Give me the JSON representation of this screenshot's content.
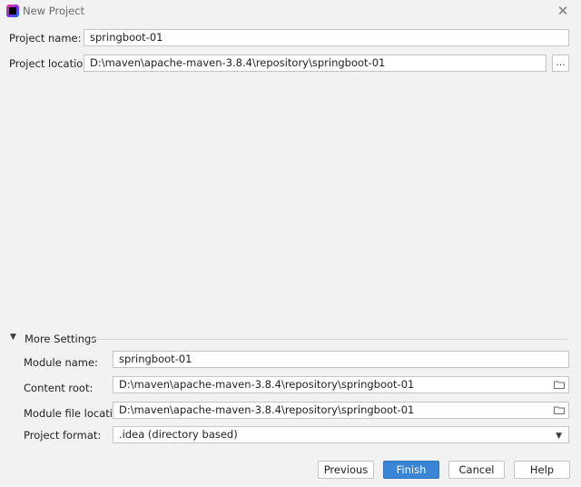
{
  "window": {
    "title": "New Project",
    "app_icon": "intellij-idea-icon",
    "close_glyph": "✕"
  },
  "project": {
    "name_label": "Project name:",
    "name_value": "springboot-01",
    "location_label": "Project location:",
    "location_value": "D:\\maven\\apache-maven-3.8.4\\repository\\springboot-01",
    "browse_label": "..."
  },
  "more_settings": {
    "toggle_icon": "triangle-down-icon",
    "title": "More Settings",
    "module_name_label": "Module name:",
    "module_name_value": "springboot-01",
    "content_root_label": "Content root:",
    "content_root_value": "D:\\maven\\apache-maven-3.8.4\\repository\\springboot-01",
    "module_file_label": "Module file location:",
    "module_file_value": "D:\\maven\\apache-maven-3.8.4\\repository\\springboot-01",
    "project_format_label": "Project format:",
    "project_format_value": ".idea (directory based)"
  },
  "buttons": {
    "previous": "Previous",
    "finish": "Finish",
    "cancel": "Cancel",
    "help": "Help"
  },
  "colors": {
    "background": "#f2f2f2",
    "primary_button": "#3a85d5",
    "field_border": "#c4c4c4"
  }
}
